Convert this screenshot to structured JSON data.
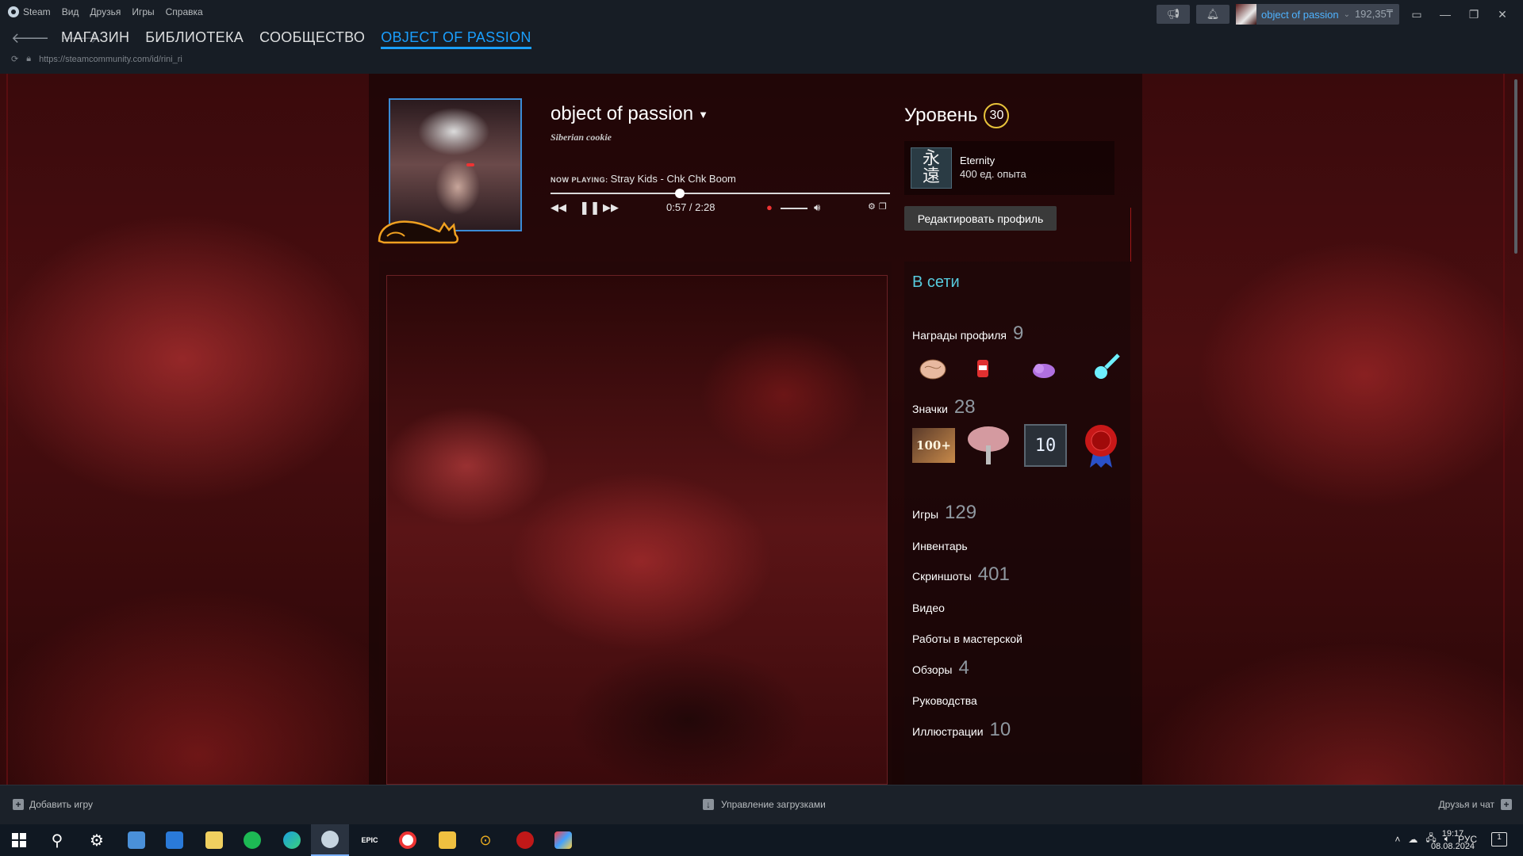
{
  "menubar": {
    "app": "Steam",
    "items": [
      "Вид",
      "Друзья",
      "Игры",
      "Справка"
    ]
  },
  "account": {
    "name": "object of passion",
    "balance": "192,35₸"
  },
  "nav": {
    "store": "МАГАЗИН",
    "library": "БИБЛИОТЕКА",
    "community": "СООБЩЕСТВО",
    "profile": "OBJECT OF PASSION"
  },
  "url": "https://steamcommunity.com/id/rini_ri",
  "profile": {
    "name": "object of passion",
    "subtitle": "Siberian cookie"
  },
  "player": {
    "label": "NOW PLAYING:",
    "track": "Stray Kids - Chk Chk Boom",
    "time": "0:57 / 2:28",
    "progress": 0.38
  },
  "level": {
    "label": "Уровень",
    "value": "30"
  },
  "featured_badge": {
    "glyph": "永\n遠",
    "name": "Eternity",
    "xp": "400 ед. опыта"
  },
  "edit_profile": "Редактировать профиль",
  "status": "В сети",
  "awards": {
    "label": "Награды профиля",
    "count": "9"
  },
  "badges": {
    "label": "Значки",
    "count": "28",
    "badge_100": "100+",
    "badge_10": "10"
  },
  "stats": [
    {
      "label": "Игры",
      "count": "129"
    },
    {
      "label": "Инвентарь",
      "count": ""
    },
    {
      "label": "Скриншоты",
      "count": "401"
    },
    {
      "label": "Видео",
      "count": ""
    },
    {
      "label": "Работы в мастерской",
      "count": ""
    },
    {
      "label": "Обзоры",
      "count": "4"
    },
    {
      "label": "Руководства",
      "count": ""
    },
    {
      "label": "Иллюстрации",
      "count": "10"
    }
  ],
  "bottom": {
    "add_game": "Добавить игру",
    "downloads": "Управление загрузками",
    "friends": "Друзья и чат"
  },
  "taskbar": {
    "lang": "РУС",
    "time": "19:17",
    "date": "08.08.2024",
    "notifications": "1"
  },
  "colors": {
    "accent": "#1a9fff",
    "online": "#57cbde",
    "level_ring": "#e8c33b"
  }
}
